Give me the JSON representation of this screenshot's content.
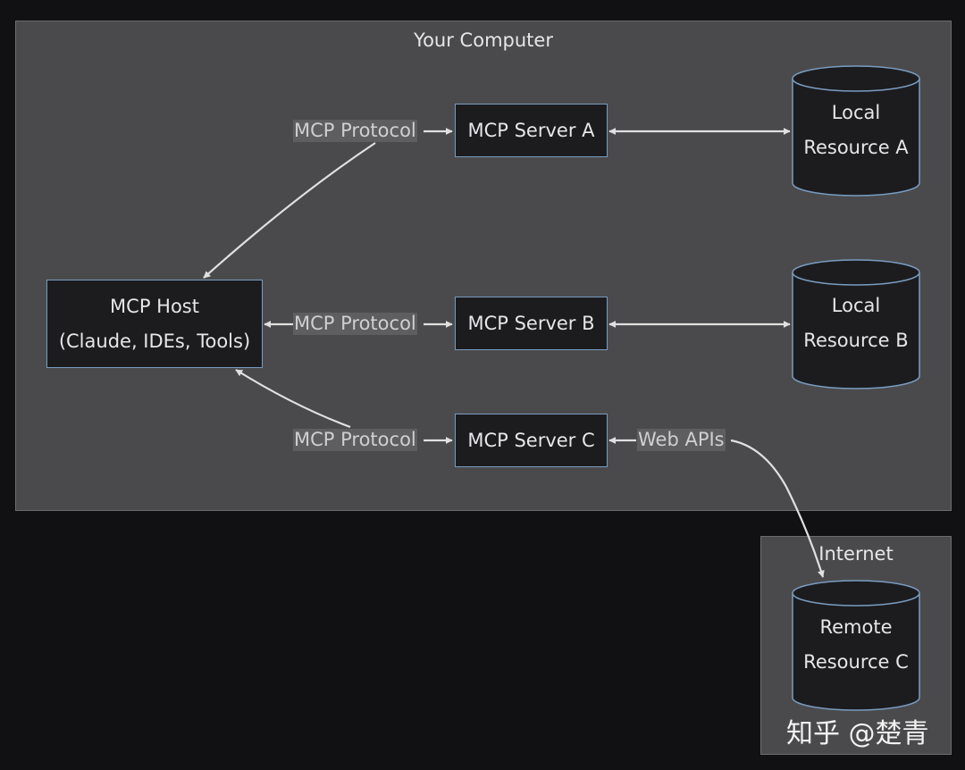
{
  "clusters": {
    "computer": {
      "title": "Your Computer"
    },
    "internet": {
      "title": "Internet"
    }
  },
  "nodes": {
    "host": {
      "line1": "MCP Host",
      "line2": "(Claude, IDEs, Tools)"
    },
    "server_a": {
      "label": "MCP Server A"
    },
    "server_b": {
      "label": "MCP Server B"
    },
    "server_c": {
      "label": "MCP Server C"
    }
  },
  "resources": {
    "local_a": {
      "line1": "Local",
      "line2": "Resource A"
    },
    "local_b": {
      "line1": "Local",
      "line2": "Resource B"
    },
    "remote_c": {
      "line1": "Remote",
      "line2": "Resource C"
    }
  },
  "edges": {
    "host_a": {
      "label": "MCP Protocol"
    },
    "host_b": {
      "label": "MCP Protocol"
    },
    "host_c": {
      "label": "MCP Protocol"
    },
    "c_remote": {
      "label": "Web APIs"
    }
  },
  "colors": {
    "cluster_fill": "#4a4a4c",
    "node_fill": "#1c1c1f",
    "node_border": "#7a9cc0",
    "edge": "#e0e0e0"
  },
  "watermark": "知乎 @楚青"
}
